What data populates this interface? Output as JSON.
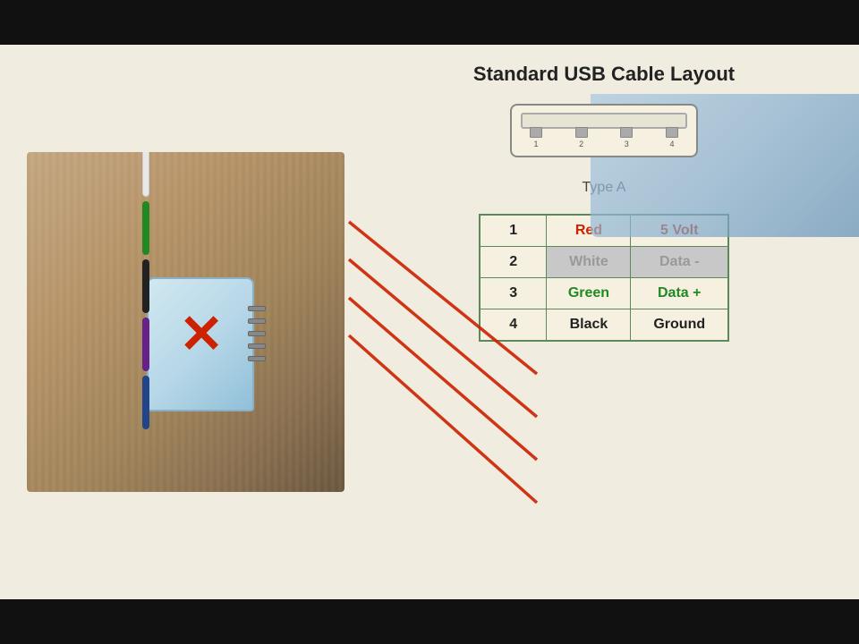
{
  "bars": {
    "top": "top-bar",
    "bottom": "bottom-bar"
  },
  "diagram": {
    "title": "Standard USB Cable Layout",
    "type_label": "Type A",
    "pin_numbers": [
      "1",
      "2",
      "3",
      "4"
    ]
  },
  "table": {
    "rows": [
      {
        "num": "1",
        "color": "Red",
        "function": "5 Volt"
      },
      {
        "num": "2",
        "color": "White",
        "function": "Data -"
      },
      {
        "num": "3",
        "color": "Green",
        "function": "Data +"
      },
      {
        "num": "4",
        "color": "Black",
        "function": "Ground"
      }
    ]
  },
  "x_mark": "✕"
}
